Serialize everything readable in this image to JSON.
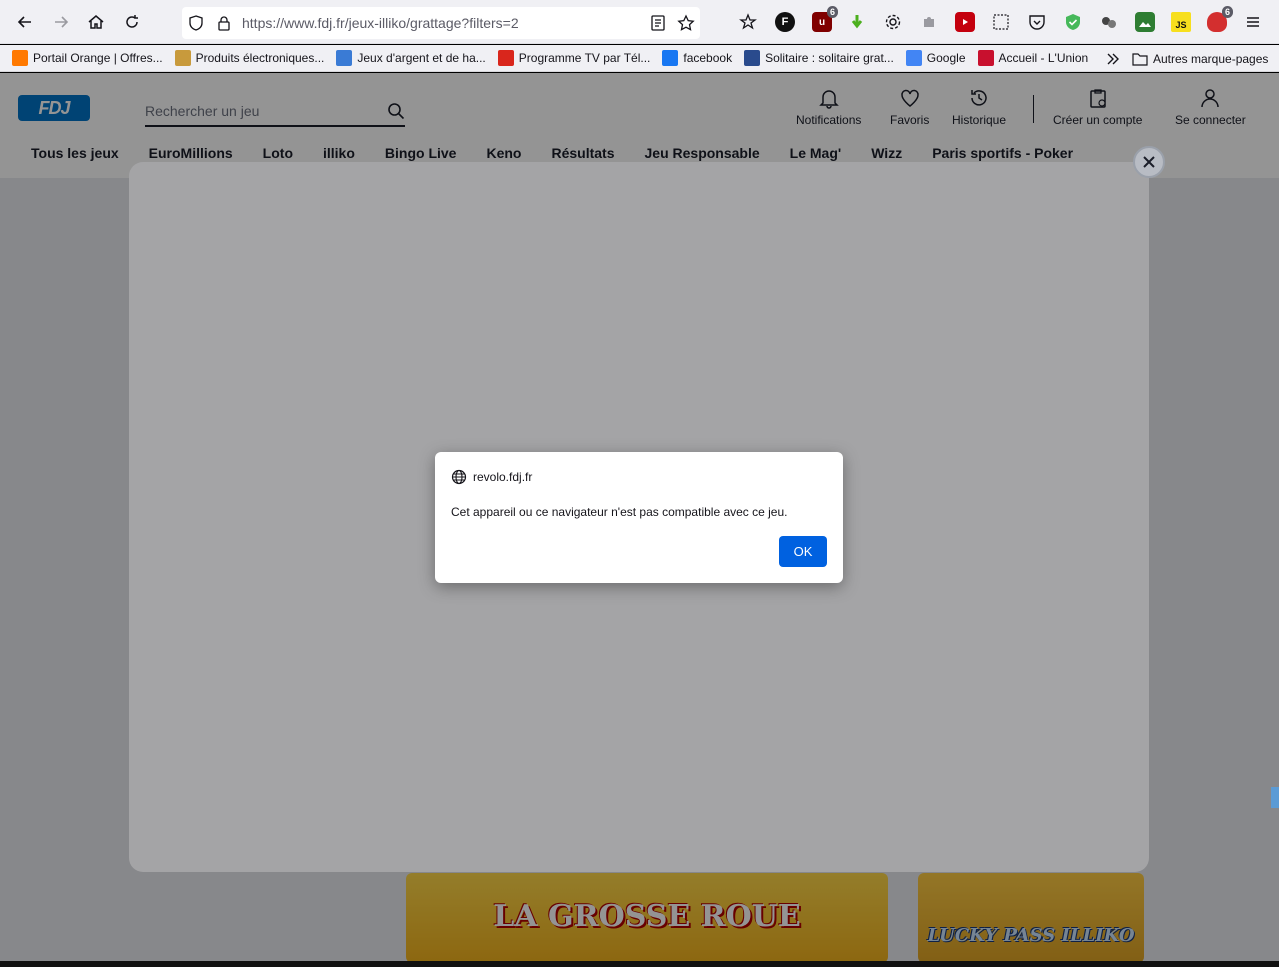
{
  "browser": {
    "url": "https://www.fdj.fr/jeux-illiko/grattage?filters=2",
    "ext_badge_1": "6",
    "ext_badge_2": "6",
    "ext_js_label": "JS",
    "ext_f_label": "F"
  },
  "bookmarks": [
    {
      "label": "Portail Orange | Offres...",
      "color": "#ff7900"
    },
    {
      "label": "Produits électroniques...",
      "color": "#c89a3c"
    },
    {
      "label": "Jeux d'argent et de ha...",
      "color": "#3a7bd5"
    },
    {
      "label": "Programme TV par Tél...",
      "color": "#d9261c"
    },
    {
      "label": "facebook",
      "color": "#1877f2"
    },
    {
      "label": "Solitaire : solitaire grat...",
      "color": "#2a4b8d"
    },
    {
      "label": "Google",
      "color": "#4285f4"
    },
    {
      "label": "Accueil - L'Union",
      "color": "#c8102e"
    }
  ],
  "bookmarks_other": "Autres marque-pages",
  "site": {
    "logo": "FDJ",
    "search_placeholder": "Rechercher un jeu",
    "header_buttons": {
      "notifications": "Notifications",
      "favorites": "Favoris",
      "history": "Historique",
      "create_account": "Créer un compte",
      "login": "Se connecter"
    },
    "nav": [
      "Tous les jeux",
      "EuroMillions",
      "Loto",
      "illiko",
      "Bingo Live",
      "Keno",
      "Résultats",
      "Jeu Responsable",
      "Le Mag'",
      "Wizz",
      "Paris sportifs - Poker"
    ],
    "promos": [
      "LA GROSSE ROUE",
      "LUCKY PASS ILLIKO"
    ]
  },
  "alert": {
    "origin": "revolo.fdj.fr",
    "message": "Cet appareil ou ce navigateur n'est pas compatible avec ce jeu.",
    "ok_label": "OK"
  },
  "colors": {
    "brand": "#0074c8",
    "ok_button": "#0061e0"
  }
}
